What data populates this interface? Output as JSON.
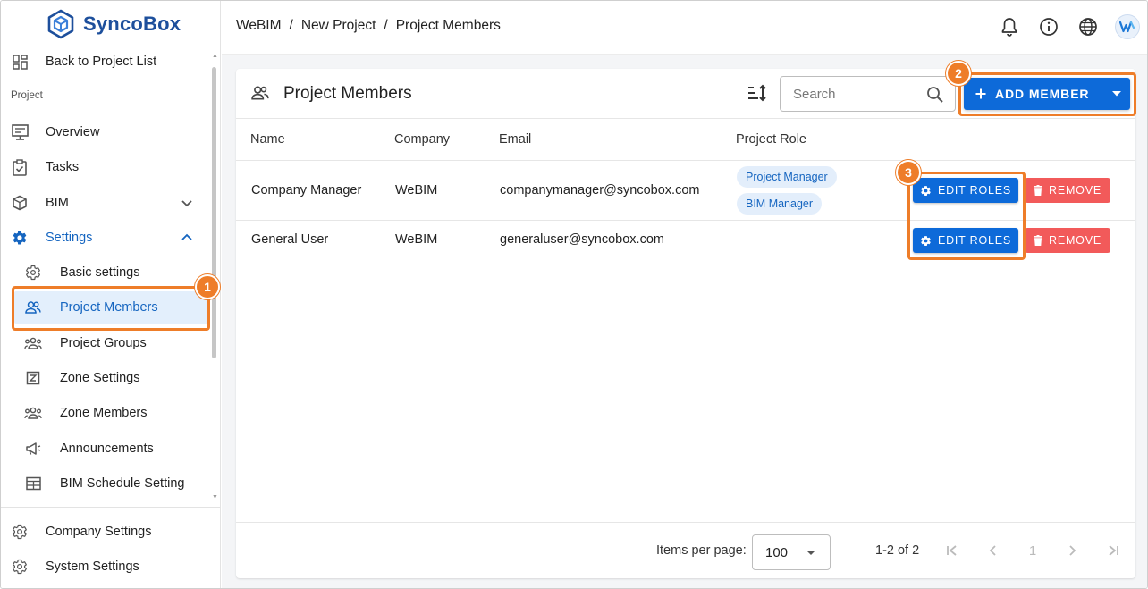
{
  "app": {
    "logo_text": "SyncoBox"
  },
  "sidebar": {
    "back_label": "Back to Project List",
    "section_label": "Project",
    "items": [
      {
        "label": "Overview",
        "icon": "monitor-icon"
      },
      {
        "label": "Tasks",
        "icon": "clipboard-check-icon"
      },
      {
        "label": "BIM",
        "icon": "cube-icon",
        "expanded": false
      },
      {
        "label": "Settings",
        "icon": "gear-icon",
        "expanded": true
      }
    ],
    "sub_items": [
      {
        "label": "Basic settings",
        "icon": "gear-icon"
      },
      {
        "label": "Project Members",
        "icon": "people-icon",
        "selected": true
      },
      {
        "label": "Project Groups",
        "icon": "groups-icon"
      },
      {
        "label": "Zone Settings",
        "icon": "zone-icon"
      },
      {
        "label": "Zone Members",
        "icon": "groups-icon"
      },
      {
        "label": "Announcements",
        "icon": "megaphone-icon"
      },
      {
        "label": "BIM Schedule Setting",
        "icon": "table-icon"
      }
    ],
    "bottom_items": [
      {
        "label": "Company Settings",
        "icon": "gear-icon"
      },
      {
        "label": "System Settings",
        "icon": "gear-icon"
      }
    ]
  },
  "header": {
    "breadcrumb": [
      "WeBIM",
      "/",
      "New Project",
      "/",
      "Project Members"
    ],
    "icons": [
      "bell-icon",
      "info-icon",
      "globe-icon",
      "avatar"
    ]
  },
  "panel": {
    "title": "Project Members",
    "search_placeholder": "Search",
    "add_label": "ADD MEMBER",
    "columns": [
      "Name",
      "Company",
      "Email",
      "Project Role"
    ],
    "rows": [
      {
        "name": "Company Manager",
        "company": "WeBIM",
        "email": "companymanager@syncobox.com",
        "roles": [
          "Project Manager",
          "BIM Manager"
        ],
        "edit_label": "EDIT ROLES",
        "remove_label": "REMOVE"
      },
      {
        "name": "General User",
        "company": "WeBIM",
        "email": "generaluser@syncobox.com",
        "roles": [],
        "edit_label": "EDIT ROLES",
        "remove_label": "REMOVE"
      }
    ],
    "footer": {
      "items_per_page_label": "Items per page:",
      "items_per_page_value": "100",
      "range": "1-2 of 2",
      "current_page": "1"
    }
  },
  "annotations": {
    "badges": [
      "1",
      "2",
      "3"
    ],
    "color": "#ee7d29"
  },
  "colors": {
    "primary": "#0d6ad9",
    "danger": "#f25a5a",
    "brand": "#1d4f9c",
    "chip_bg": "#e3eefb"
  }
}
